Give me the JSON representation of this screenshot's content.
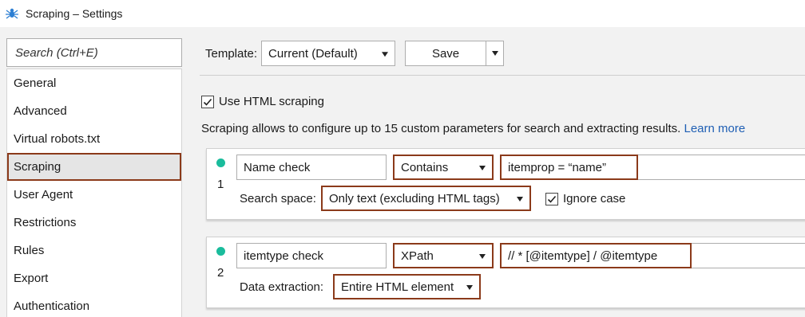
{
  "window": {
    "title": "Scraping – Settings",
    "icon": "spider-icon"
  },
  "sidebar": {
    "search_placeholder": "Search (Ctrl+E)",
    "items": [
      {
        "label": "General"
      },
      {
        "label": "Advanced"
      },
      {
        "label": "Virtual robots.txt"
      },
      {
        "label": "Scraping",
        "active": true
      },
      {
        "label": "User Agent"
      },
      {
        "label": "Restrictions"
      },
      {
        "label": "Rules"
      },
      {
        "label": "Export"
      },
      {
        "label": "Authentication"
      }
    ]
  },
  "toolbar": {
    "template_label": "Template:",
    "template_value": "Current (Default)",
    "save_label": "Save"
  },
  "scraping": {
    "use_html_label": "Use HTML scraping",
    "use_html_checked": true,
    "description": "Scraping allows to configure up to 15 custom parameters for search and extracting results.",
    "learn_more": "Learn more"
  },
  "rules": [
    {
      "number": "1",
      "name": "Name check",
      "mode": "Contains",
      "expression": "itemprop = “name”",
      "sub_label": "Search space:",
      "sub_value": "Only text (excluding HTML tags)",
      "ignore_case_label": "Ignore case",
      "ignore_case_checked": true
    },
    {
      "number": "2",
      "name": "itemtype check",
      "mode": "XPath",
      "expression": "// * [@itemtype] / @itemtype",
      "sub_label": "Data extraction:",
      "sub_value": "Entire HTML element"
    }
  ],
  "colors": {
    "highlight": "#8b3a1a",
    "status_dot": "#1abc9c",
    "link": "#1f5fb4"
  }
}
